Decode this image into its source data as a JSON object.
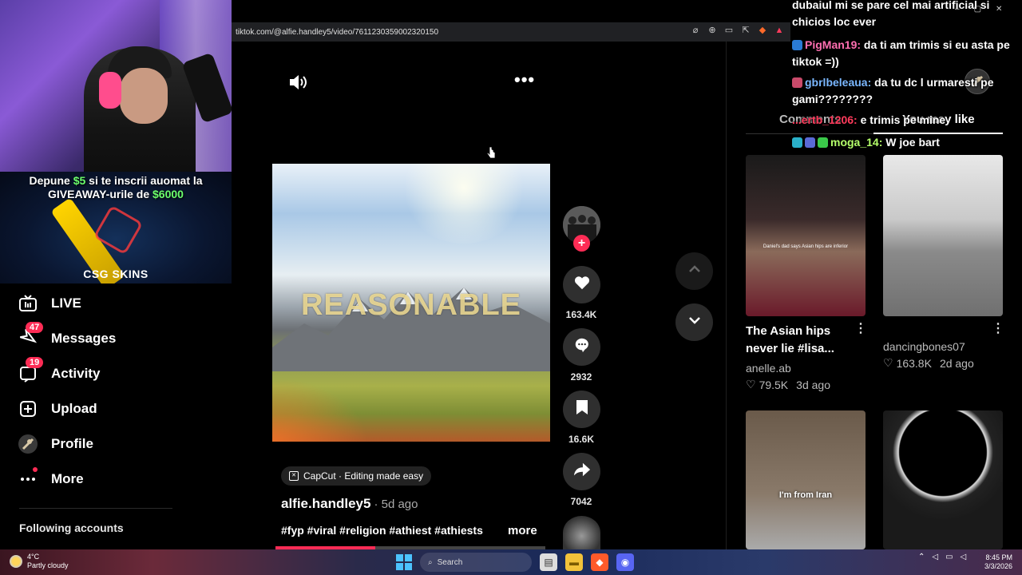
{
  "browser": {
    "url": "tiktok.com/@alfie.handley5/video/7611230359002320150"
  },
  "stream": {
    "sponsor_line1_pre": "Depune ",
    "sponsor_amount1": "$5",
    "sponsor_line1_post": " si te inscrii auomat la",
    "sponsor_line2_pre": "GIVEAWAY-urile de ",
    "sponsor_amount2": "$6000",
    "sponsor_brand": "CSG SKINS"
  },
  "nav": {
    "items": [
      {
        "label": "LIVE",
        "icon": "live-icon"
      },
      {
        "label": "Messages",
        "icon": "messages-icon",
        "badge": "47"
      },
      {
        "label": "Activity",
        "icon": "activity-icon",
        "badge": "19"
      },
      {
        "label": "Upload",
        "icon": "upload-icon"
      },
      {
        "label": "Profile",
        "icon": "profile-avatar"
      },
      {
        "label": "More",
        "icon": "more-icon"
      }
    ],
    "following_label": "Following accounts"
  },
  "video": {
    "overlay_text": "REASONABLE",
    "likes": "163.4K",
    "comments": "2932",
    "saves": "16.6K",
    "shares": "7042",
    "progress_fraction": 0.37
  },
  "caption": {
    "capcut_label": "CapCut · Editing made easy",
    "author": "alfie.handley5",
    "posted": "· 5d ago",
    "tags": "#fyp #viral #religion #athiest #athiests",
    "more_label": "more"
  },
  "right_panel": {
    "tab_comments": "Comments",
    "tab_like": "You may like",
    "cards": [
      {
        "title": "The Asian hips never lie #lisa...",
        "author": "anelle.ab",
        "likes": "79.5K",
        "when": "3d ago",
        "thumb_text": "Daniel's dad says Asian hips are inferior"
      },
      {
        "title": "",
        "author": "dancingbones07",
        "likes": "163.8K",
        "when": "2d ago"
      },
      {
        "thumb_caption": "I'm from Iran"
      },
      {}
    ]
  },
  "chat": {
    "messages": [
      {
        "user": "",
        "text": "dubaiul mi se pare cel mai artificial si chicios loc ever"
      },
      {
        "user": "PigMan19:",
        "text": "da ti am trimis si eu asta pe tiktok =))"
      },
      {
        "user": "gbrlbeleaua:",
        "text": "da tu dc l urmaresti pe gami????????"
      },
      {
        "user": "...ertb_1206:",
        "text": "e trimis pe mine"
      },
      {
        "user": "moga_14:",
        "text": "W joe bart"
      }
    ]
  },
  "taskbar": {
    "temp": "4°C",
    "weather": "Partly cloudy",
    "search": "Search",
    "time": "8:45 PM",
    "date": "3/3/2026"
  },
  "colors": {
    "accent": "#fe2c55",
    "sponsor_green": "#6cff6c"
  }
}
